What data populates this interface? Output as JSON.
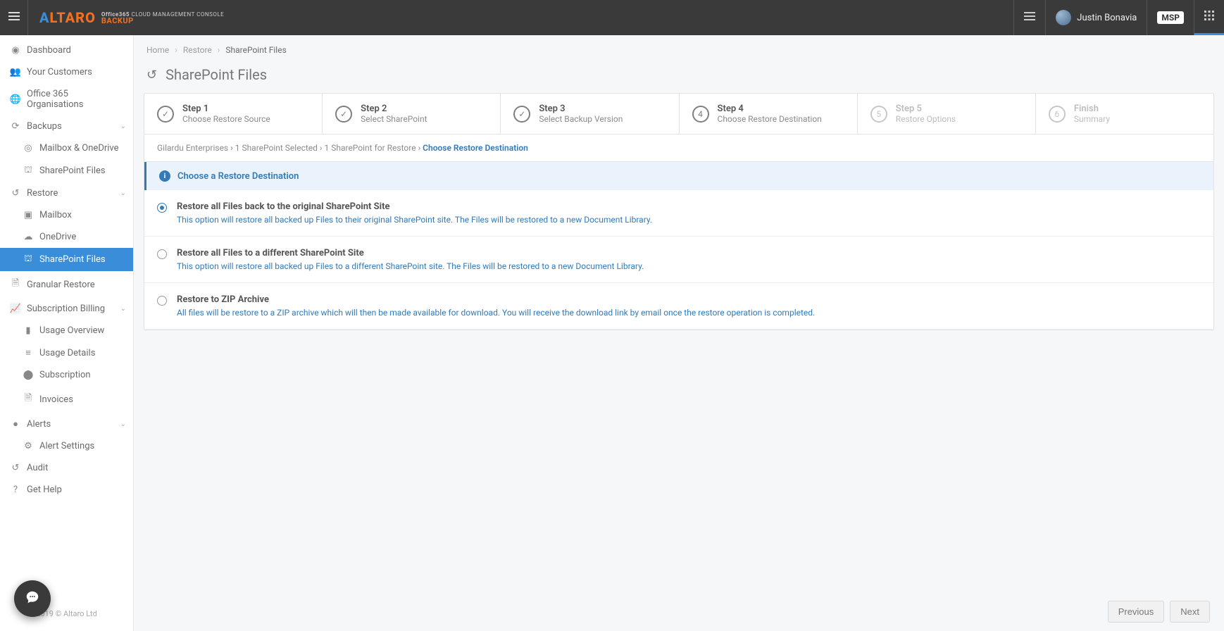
{
  "brand": {
    "logo_main": "LTARO",
    "logo_a": "A",
    "sub_line1": "Office365",
    "sub_line2": "BACKUP",
    "sub_line3": "CLOUD MANAGEMENT CONSOLE"
  },
  "topbar": {
    "user_name": "Justin Bonavia",
    "msp_label": "MSP"
  },
  "sidebar": {
    "items": [
      {
        "label": "Dashboard"
      },
      {
        "label": "Your Customers"
      },
      {
        "label": "Office 365 Organisations"
      },
      {
        "label": "Backups"
      },
      {
        "label": "Mailbox & OneDrive"
      },
      {
        "label": "SharePoint Files"
      },
      {
        "label": "Restore"
      },
      {
        "label": "Mailbox"
      },
      {
        "label": "OneDrive"
      },
      {
        "label": "SharePoint Files"
      },
      {
        "label": "Granular Restore"
      },
      {
        "label": "Subscription Billing"
      },
      {
        "label": "Usage Overview"
      },
      {
        "label": "Usage Details"
      },
      {
        "label": "Subscription"
      },
      {
        "label": "Invoices"
      },
      {
        "label": "Alerts"
      },
      {
        "label": "Alert Settings"
      },
      {
        "label": "Audit"
      },
      {
        "label": "Get Help"
      }
    ],
    "copyright": "2019 © Altaro Ltd"
  },
  "breadcrumb": {
    "home": "Home",
    "restore": "Restore",
    "current": "SharePoint Files"
  },
  "page": {
    "title": "SharePoint Files"
  },
  "stepper": {
    "s1": {
      "title": "Step 1",
      "sub": "Choose Restore Source"
    },
    "s2": {
      "title": "Step 2",
      "sub": "Select SharePoint"
    },
    "s3": {
      "title": "Step 3",
      "sub": "Select Backup Version"
    },
    "s4": {
      "title": "Step 4",
      "sub": "Choose Restore Destination",
      "num": "4"
    },
    "s5": {
      "title": "Step 5",
      "sub": "Restore Options",
      "num": "5"
    },
    "s6": {
      "title": "Finish",
      "sub": "Summary",
      "num": "6"
    }
  },
  "sub_crumbs": {
    "a": "Gilardu Enterprises",
    "b": "1 SharePoint Selected",
    "c": "1 SharePoint for Restore",
    "d": "Choose Restore Destination"
  },
  "info": {
    "text": "Choose a Restore Destination"
  },
  "options": {
    "o1": {
      "title": "Restore all Files back to the original SharePoint Site",
      "desc": "This option will restore all backed up Files to their original SharePoint site. The Files will be restored to a new Document Library."
    },
    "o2": {
      "title": "Restore all Files to a different SharePoint Site",
      "desc": "This option will restore all backed up Files to a different SharePoint site. The Files will be restored to a new Document Library."
    },
    "o3": {
      "title": "Restore to ZIP Archive",
      "desc": "All files will be restore to a ZIP archive which will then be made available for download. You will receive the download link by email once the restore operation is completed."
    }
  },
  "actions": {
    "previous": "Previous",
    "next": "Next"
  }
}
